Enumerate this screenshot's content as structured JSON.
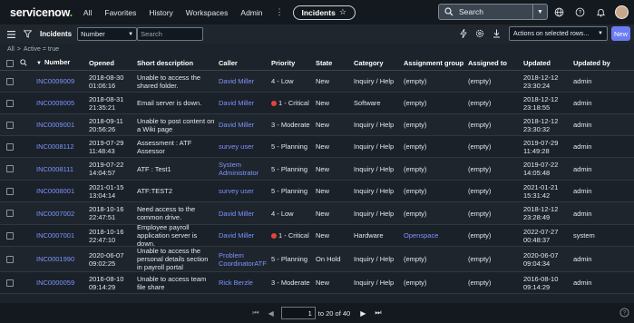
{
  "app": {
    "logo_text": "servicenow",
    "logo_dot": "."
  },
  "nav": {
    "items": [
      "All",
      "Favorites",
      "History",
      "Workspaces",
      "Admin"
    ],
    "more": "⋮",
    "context_pill": "Incidents",
    "star": "☆"
  },
  "global_search": {
    "label": "Search"
  },
  "list": {
    "title": "Incidents",
    "search_field": "Number",
    "search_placeholder": "Search",
    "actions_label": "Actions on selected rows...",
    "new_label": "New"
  },
  "breadcrumb": {
    "root": "All",
    "sep": ">",
    "filter": "Active = true"
  },
  "columns": [
    "Number",
    "Opened",
    "Short description",
    "Caller",
    "Priority",
    "State",
    "Category",
    "Assignment group",
    "Assigned to",
    "Updated",
    "Updated by"
  ],
  "rows": [
    {
      "number": "INC0009009",
      "opened": "2018-08-30 01:06:16",
      "desc": "Unable to access the shared folder.",
      "caller": "David Miller",
      "priority": "4 - Low",
      "critical": false,
      "state": "New",
      "category": "Inquiry / Help",
      "group": "(empty)",
      "group_link": false,
      "assigned": "(empty)",
      "updated": "2018-12-12 23:30:24",
      "updated_by": "admin"
    },
    {
      "number": "INC0009005",
      "opened": "2018-08-31 21:35:21",
      "desc": "Email server is down.",
      "caller": "David Miller",
      "priority": "1 - Critical",
      "critical": true,
      "state": "New",
      "category": "Software",
      "group": "(empty)",
      "group_link": false,
      "assigned": "(empty)",
      "updated": "2018-12-12 23:18:55",
      "updated_by": "admin"
    },
    {
      "number": "INC0009001",
      "opened": "2018-09-11 20:56:26",
      "desc": "Unable to post content on a Wiki page",
      "caller": "David Miller",
      "priority": "3 - Moderate",
      "critical": false,
      "state": "New",
      "category": "Inquiry / Help",
      "group": "(empty)",
      "group_link": false,
      "assigned": "(empty)",
      "updated": "2018-12-12 23:30:32",
      "updated_by": "admin"
    },
    {
      "number": "INC0008112",
      "opened": "2019-07-29 11:48:43",
      "desc": "Assessment : ATF Assessor",
      "caller": "survey user",
      "priority": "5 - Planning",
      "critical": false,
      "state": "New",
      "category": "Inquiry / Help",
      "group": "(empty)",
      "group_link": false,
      "assigned": "(empty)",
      "updated": "2019-07-29 11:49:28",
      "updated_by": "admin"
    },
    {
      "number": "INC0008111",
      "opened": "2019-07-22 14:04:57",
      "desc": "ATF : Test1",
      "caller": "System Administrator",
      "priority": "5 - Planning",
      "critical": false,
      "state": "New",
      "category": "Inquiry / Help",
      "group": "(empty)",
      "group_link": false,
      "assigned": "(empty)",
      "updated": "2019-07-22 14:05:48",
      "updated_by": "admin"
    },
    {
      "number": "INC0008001",
      "opened": "2021-01-15 13:04:14",
      "desc": "ATF:TEST2",
      "caller": "survey user",
      "priority": "5 - Planning",
      "critical": false,
      "state": "New",
      "category": "Inquiry / Help",
      "group": "(empty)",
      "group_link": false,
      "assigned": "(empty)",
      "updated": "2021-01-21 15:31:42",
      "updated_by": "admin"
    },
    {
      "number": "INC0007002",
      "opened": "2018-10-16 22:47:51",
      "desc": "Need access to the common drive.",
      "caller": "David Miller",
      "priority": "4 - Low",
      "critical": false,
      "state": "New",
      "category": "Inquiry / Help",
      "group": "(empty)",
      "group_link": false,
      "assigned": "(empty)",
      "updated": "2018-12-12 23:28:49",
      "updated_by": "admin"
    },
    {
      "number": "INC0007001",
      "opened": "2018-10-16 22:47:10",
      "desc": "Employee payroll application server is down.",
      "caller": "David Miller",
      "priority": "1 - Critical",
      "critical": true,
      "state": "New",
      "category": "Hardware",
      "group": "Openspace",
      "group_link": true,
      "assigned": "(empty)",
      "updated": "2022-07-27 00:48:37",
      "updated_by": "system"
    },
    {
      "number": "INC0001990",
      "opened": "2020-06-07 09:02:25",
      "desc": "Unable to access the personal details section in payroll portal",
      "caller": "Problem CoordinatorATF",
      "priority": "5 - Planning",
      "critical": false,
      "state": "On Hold",
      "category": "Inquiry / Help",
      "group": "(empty)",
      "group_link": false,
      "assigned": "(empty)",
      "updated": "2020-06-07 09:04:34",
      "updated_by": "admin"
    },
    {
      "number": "INC0000059",
      "opened": "2016-08-10 09:14:29",
      "desc": "Unable to access team file share",
      "caller": "Rick Berzle",
      "priority": "3 - Moderate",
      "critical": false,
      "state": "New",
      "category": "Inquiry / Help",
      "group": "(empty)",
      "group_link": false,
      "assigned": "(empty)",
      "updated": "2016-08-10 09:14:29",
      "updated_by": "admin"
    }
  ],
  "pagination": {
    "current": "1",
    "text": "to 20 of 40"
  },
  "colors": {
    "link": "#7e94ff",
    "critical": "#e0473c",
    "accent": "#6b7cf2",
    "logo_dot": "#62d84e"
  }
}
